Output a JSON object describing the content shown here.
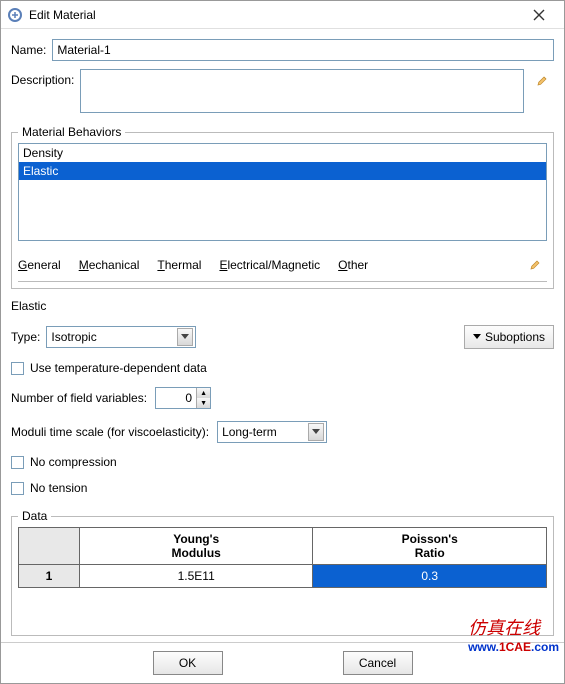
{
  "window": {
    "title": "Edit Material"
  },
  "name": {
    "label": "Name:",
    "value": "Material-1"
  },
  "description": {
    "label": "Description:",
    "value": ""
  },
  "behaviors": {
    "legend": "Material Behaviors",
    "items": [
      "Density",
      "Elastic"
    ],
    "selected_index": 1
  },
  "menu": {
    "general": "General",
    "mechanical": "Mechanical",
    "thermal": "Thermal",
    "electrical": "Electrical/Magnetic",
    "other": "Other"
  },
  "section_title": "Elastic",
  "type": {
    "label": "Type:",
    "value": "Isotropic"
  },
  "suboptions_label": "Suboptions",
  "temp_dep_label": "Use temperature-dependent data",
  "field_vars": {
    "label": "Number of field variables:",
    "value": "0"
  },
  "moduli": {
    "label": "Moduli time scale (for viscoelasticity):",
    "value": "Long-term"
  },
  "no_compression_label": "No compression",
  "no_tension_label": "No tension",
  "data": {
    "legend": "Data",
    "headers": [
      "Young's\nModulus",
      "Poisson's\nRatio"
    ],
    "row_num": "1",
    "youngs": "1.5E11",
    "poisson": "0.3"
  },
  "footer": {
    "ok": "OK",
    "cancel": "Cancel"
  },
  "watermark": {
    "cn": "仿真在线",
    "url_a": "www.",
    "url_b": "1CAE",
    "url_c": ".com"
  }
}
